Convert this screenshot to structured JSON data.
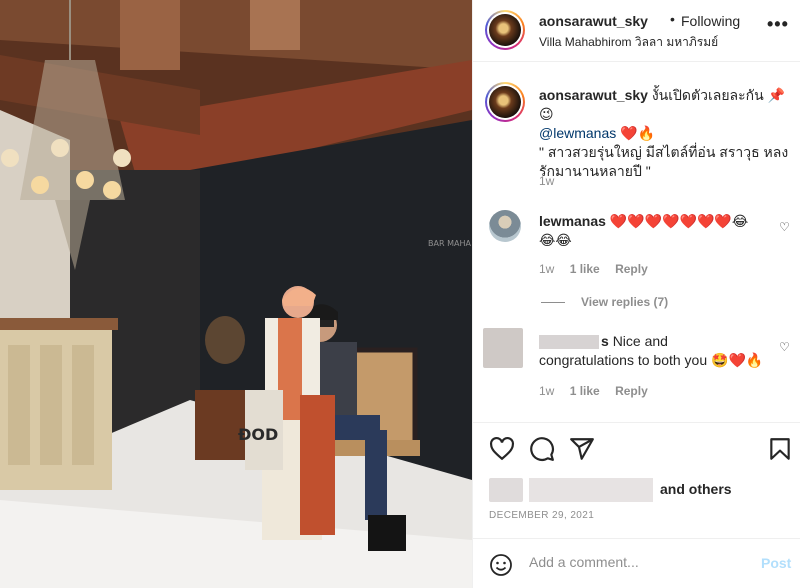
{
  "header": {
    "username": "aonsarawut_sky",
    "separator": "•",
    "follow_status": "Following",
    "location": "Villa Mahabhirom วิลลา มหาภิรมย์",
    "more_icon": "more-horizontal-icon"
  },
  "caption": {
    "username": "aonsarawut_sky",
    "line1": "งั้นเปิดตัวเลยละกัน 📌😉",
    "mention": "@lewmanas",
    "mention_emoji": "❤️🔥",
    "quote": "\" สาวสวยรุ่นใหญ่ มีสไตล์ที่อ่น สราวุธ หลงรักมานานหลายปี \"",
    "time": "1w"
  },
  "comments": [
    {
      "username": "lewmanas",
      "text": "❤️❤️❤️❤️❤️❤️❤️😂😂😂",
      "time": "1w",
      "likes": "1 like",
      "reply": "Reply"
    },
    {
      "username_suffix": "s",
      "text": "Nice and congratulations to both you 🤩❤️🔥",
      "time": "1w",
      "likes": "1 like",
      "reply": "Reply"
    }
  ],
  "view_replies": "View replies (7)",
  "likes": {
    "and_others": "and others"
  },
  "date": "DECEMBER 29, 2021",
  "comment_input": {
    "placeholder": "Add a comment...",
    "post_label": "Post"
  },
  "photo": {
    "sign_text": "BAR MAHA"
  },
  "colors": {
    "link": "#00376b",
    "muted": "#8e8e8e",
    "post_disabled": "#b2dffc",
    "heart": "#ed4956"
  }
}
